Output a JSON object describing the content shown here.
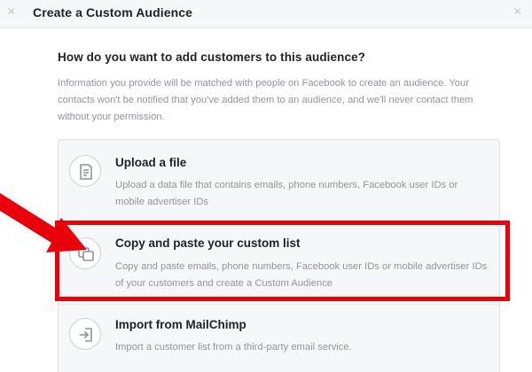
{
  "dialog": {
    "title": "Create a Custom Audience",
    "close_glyph": "×"
  },
  "content": {
    "question": "How do you want to add customers to this audience?",
    "info": "Information you provide will be matched with people on Facebook to create an audience. Your contacts won't be notified that you've added them to an audience, and we'll never contact them without your permission."
  },
  "options": [
    {
      "icon": "document-icon",
      "title": "Upload a file",
      "description": "Upload a data file that contains emails, phone numbers, Facebook user IDs or mobile advertiser IDs"
    },
    {
      "icon": "copy-paste-icon",
      "title": "Copy and paste your custom list",
      "description": "Copy and paste emails, phone numbers, Facebook user IDs or mobile advertiser IDs of your customers and create a Custom Audience"
    },
    {
      "icon": "import-icon",
      "title": "Import from MailChimp",
      "description": "Import a customer list from a third-party email service."
    }
  ],
  "annotation": {
    "highlight_color": "#e8000b"
  }
}
